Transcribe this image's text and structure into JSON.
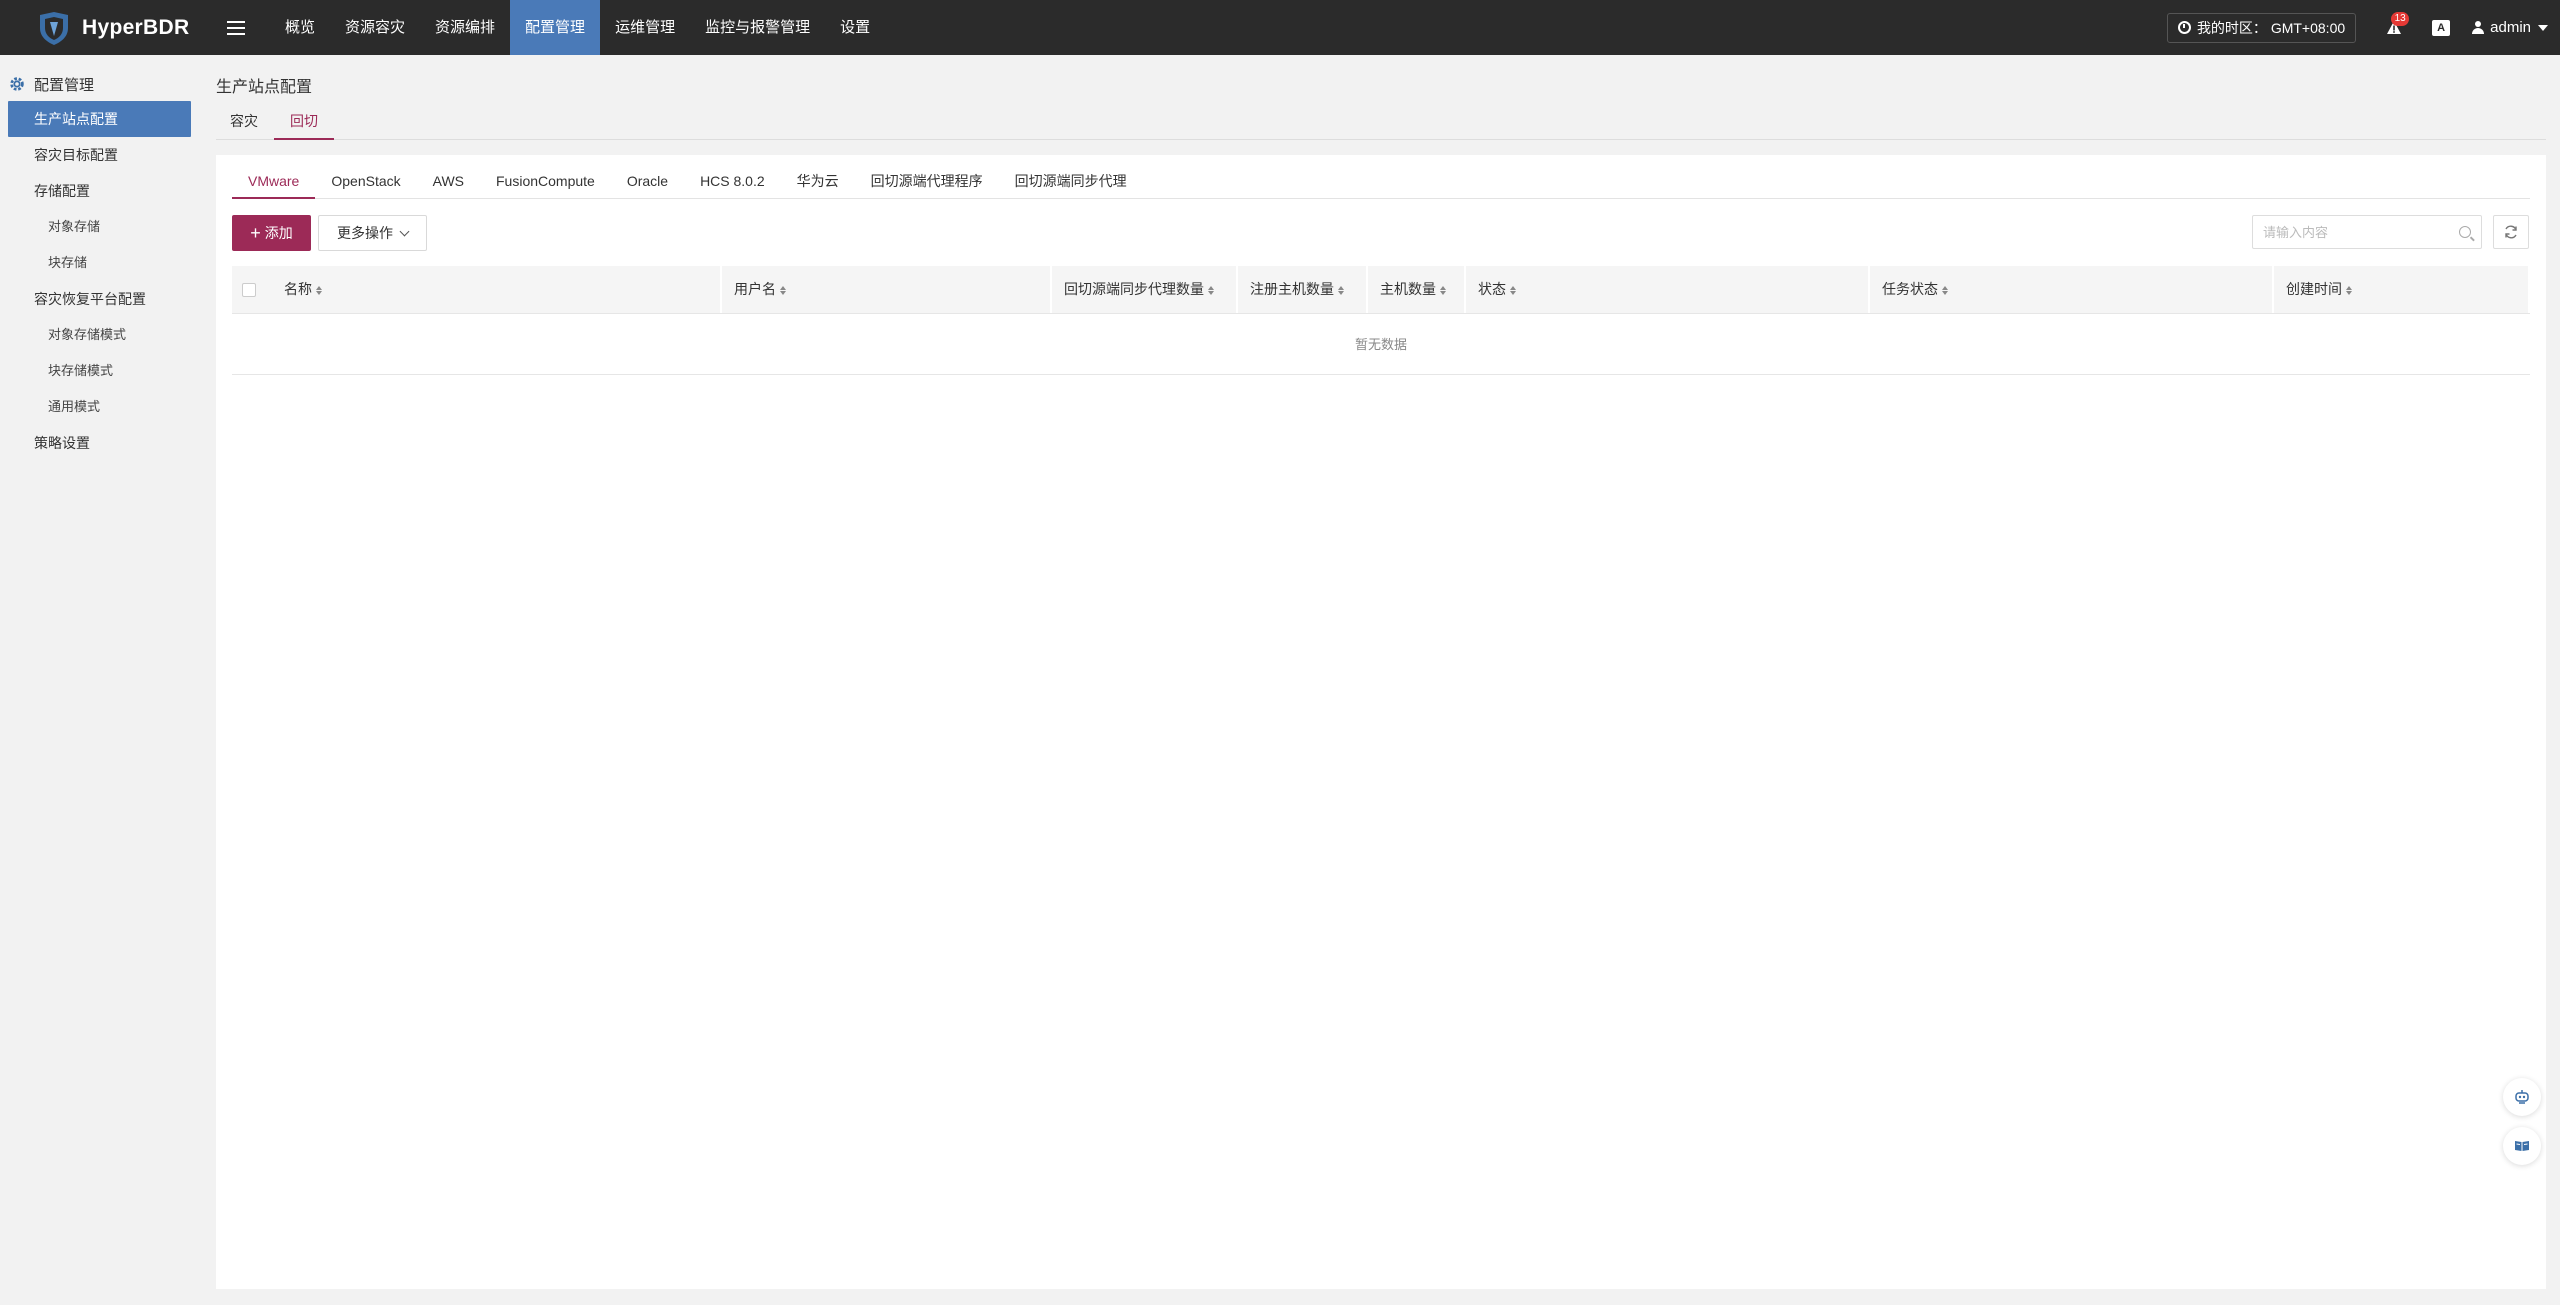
{
  "app": {
    "name": "HyperBDR"
  },
  "nav": {
    "items": [
      "概览",
      "资源容灾",
      "资源编排",
      "配置管理",
      "运维管理",
      "监控与报警管理",
      "设置"
    ],
    "active_index": 3
  },
  "topright": {
    "timezone": "我的时区： GMT+08:00",
    "alert_count": "13",
    "lang": "A",
    "user": "admin"
  },
  "sidebar": {
    "header": "配置管理",
    "items": [
      {
        "label": "生产站点配置",
        "level": 1,
        "active": true
      },
      {
        "label": "容灾目标配置",
        "level": 1
      },
      {
        "label": "存储配置",
        "level": 1
      },
      {
        "label": "对象存储",
        "level": 2
      },
      {
        "label": "块存储",
        "level": 2
      },
      {
        "label": "容灾恢复平台配置",
        "level": 1
      },
      {
        "label": "对象存储模式",
        "level": 2
      },
      {
        "label": "块存储模式",
        "level": 2
      },
      {
        "label": "通用模式",
        "level": 2
      },
      {
        "label": "策略设置",
        "level": 1
      }
    ]
  },
  "page": {
    "title": "生产站点配置",
    "tabs": [
      "容灾",
      "回切"
    ],
    "active_tab": 1
  },
  "subtabs": {
    "items": [
      "VMware",
      "OpenStack",
      "AWS",
      "FusionCompute",
      "Oracle",
      "HCS 8.0.2",
      "华为云",
      "回切源端代理程序",
      "回切源端同步代理"
    ],
    "active_index": 0
  },
  "toolbar": {
    "add_label": "添加",
    "more_label": "更多操作",
    "search_placeholder": "请输入内容"
  },
  "table": {
    "columns": [
      "名称",
      "用户名",
      "回切源端同步代理数量",
      "注册主机数量",
      "主机数量",
      "状态",
      "任务状态",
      "创建时间"
    ],
    "empty_text": "暂无数据"
  },
  "colors": {
    "topbar": "#2b2b2b",
    "nav_active": "#4a7ab8",
    "accent": "#9c2a57",
    "badge": "#e53935"
  }
}
